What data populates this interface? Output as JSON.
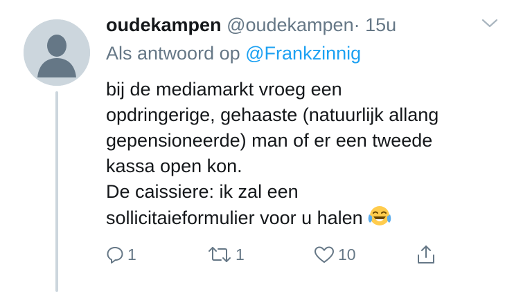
{
  "tweet": {
    "author_name": "oudekampen",
    "author_handle": "@oudekampen",
    "separator": "·",
    "timestamp": "15u",
    "reply_prefix": "Als antwoord op",
    "reply_mention": "@Frankzinnig",
    "body_lines": [
      "bij de mediamarkt vroeg een",
      "opdringerige, gehaaste (natuurlijk allang",
      "gepensioneerde) man of er een tweede",
      "kassa open kon.",
      "De caissiere: ik zal een",
      "sollicitaieformulier voor u halen"
    ],
    "emoji": "tears-of-joy-emoji"
  },
  "actions": {
    "reply_count": "1",
    "retweet_count": "1",
    "like_count": "10",
    "icons": [
      "reply-icon",
      "retweet-icon",
      "like-icon",
      "share-icon"
    ]
  },
  "colors": {
    "text": "#14171a",
    "secondary": "#657786",
    "link": "#1da1f2",
    "avatar_bg": "#ccd6dd"
  }
}
